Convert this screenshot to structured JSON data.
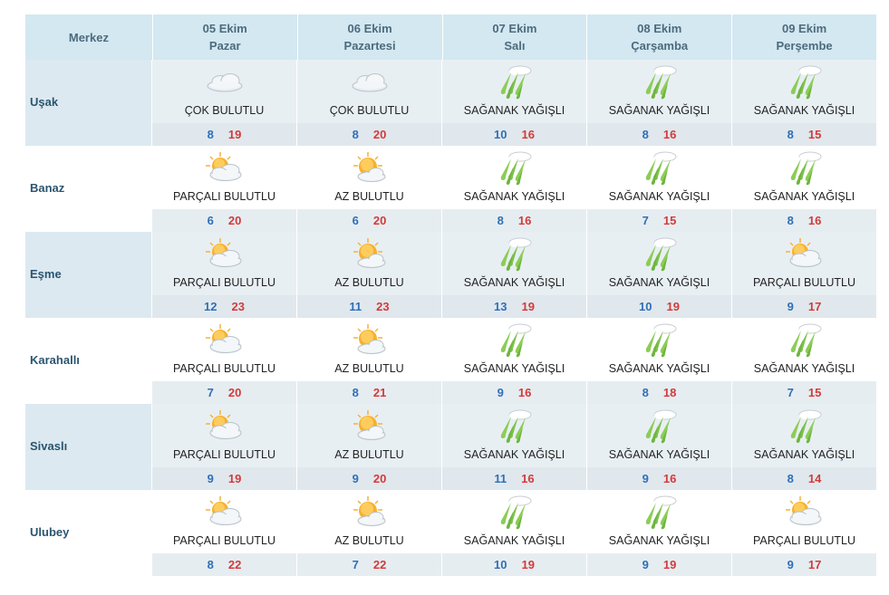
{
  "header": {
    "merkez_label": "Merkez",
    "days": [
      {
        "date": "05 Ekim",
        "weekday": "Pazar"
      },
      {
        "date": "06 Ekim",
        "weekday": "Pazartesi"
      },
      {
        "date": "07 Ekim",
        "weekday": "Salı"
      },
      {
        "date": "08 Ekim",
        "weekday": "Çarşamba"
      },
      {
        "date": "09 Ekim",
        "weekday": "Perşembe"
      }
    ]
  },
  "rows": [
    {
      "city": "Uşak",
      "days": [
        {
          "icon": "cloud-icon",
          "desc": "ÇOK BULUTLU",
          "min": "8",
          "max": "19"
        },
        {
          "icon": "cloud-icon",
          "desc": "ÇOK BULUTLU",
          "min": "8",
          "max": "20"
        },
        {
          "icon": "heavy-rain-icon",
          "desc": "SAĞANAK YAĞIŞLI",
          "min": "10",
          "max": "16"
        },
        {
          "icon": "heavy-rain-icon",
          "desc": "SAĞANAK YAĞIŞLI",
          "min": "8",
          "max": "16"
        },
        {
          "icon": "heavy-rain-icon",
          "desc": "SAĞANAK YAĞIŞLI",
          "min": "8",
          "max": "15"
        }
      ]
    },
    {
      "city": "Banaz",
      "days": [
        {
          "icon": "partly-cloudy-icon",
          "desc": "PARÇALI BULUTLU",
          "min": "6",
          "max": "20"
        },
        {
          "icon": "sun-cloud-icon",
          "desc": "AZ BULUTLU",
          "min": "6",
          "max": "20"
        },
        {
          "icon": "heavy-rain-icon",
          "desc": "SAĞANAK YAĞIŞLI",
          "min": "8",
          "max": "16"
        },
        {
          "icon": "heavy-rain-icon",
          "desc": "SAĞANAK YAĞIŞLI",
          "min": "7",
          "max": "15"
        },
        {
          "icon": "heavy-rain-icon",
          "desc": "SAĞANAK YAĞIŞLI",
          "min": "8",
          "max": "16"
        }
      ]
    },
    {
      "city": "Eşme",
      "days": [
        {
          "icon": "partly-cloudy-icon",
          "desc": "PARÇALI BULUTLU",
          "min": "12",
          "max": "23"
        },
        {
          "icon": "sun-cloud-icon",
          "desc": "AZ BULUTLU",
          "min": "11",
          "max": "23"
        },
        {
          "icon": "heavy-rain-icon",
          "desc": "SAĞANAK YAĞIŞLI",
          "min": "13",
          "max": "19"
        },
        {
          "icon": "heavy-rain-icon",
          "desc": "SAĞANAK YAĞIŞLI",
          "min": "10",
          "max": "19"
        },
        {
          "icon": "partly-cloudy-icon",
          "desc": "PARÇALI BULUTLU",
          "min": "9",
          "max": "17"
        }
      ]
    },
    {
      "city": "Karahallı",
      "days": [
        {
          "icon": "partly-cloudy-icon",
          "desc": "PARÇALI BULUTLU",
          "min": "7",
          "max": "20"
        },
        {
          "icon": "sun-cloud-icon",
          "desc": "AZ BULUTLU",
          "min": "8",
          "max": "21"
        },
        {
          "icon": "heavy-rain-icon",
          "desc": "SAĞANAK YAĞIŞLI",
          "min": "9",
          "max": "16"
        },
        {
          "icon": "heavy-rain-icon",
          "desc": "SAĞANAK YAĞIŞLI",
          "min": "8",
          "max": "18"
        },
        {
          "icon": "heavy-rain-icon",
          "desc": "SAĞANAK YAĞIŞLI",
          "min": "7",
          "max": "15"
        }
      ]
    },
    {
      "city": "Sivaslı",
      "days": [
        {
          "icon": "partly-cloudy-icon",
          "desc": "PARÇALI BULUTLU",
          "min": "9",
          "max": "19"
        },
        {
          "icon": "sun-cloud-icon",
          "desc": "AZ BULUTLU",
          "min": "9",
          "max": "20"
        },
        {
          "icon": "heavy-rain-icon",
          "desc": "SAĞANAK YAĞIŞLI",
          "min": "11",
          "max": "16"
        },
        {
          "icon": "heavy-rain-icon",
          "desc": "SAĞANAK YAĞIŞLI",
          "min": "9",
          "max": "16"
        },
        {
          "icon": "heavy-rain-icon",
          "desc": "SAĞANAK YAĞIŞLI",
          "min": "8",
          "max": "14"
        }
      ]
    },
    {
      "city": "Ulubey",
      "days": [
        {
          "icon": "partly-cloudy-icon",
          "desc": "PARÇALI BULUTLU",
          "min": "8",
          "max": "22"
        },
        {
          "icon": "sun-cloud-icon",
          "desc": "AZ BULUTLU",
          "min": "7",
          "max": "22"
        },
        {
          "icon": "heavy-rain-icon",
          "desc": "SAĞANAK YAĞIŞLI",
          "min": "10",
          "max": "19"
        },
        {
          "icon": "heavy-rain-icon",
          "desc": "SAĞANAK YAĞIŞLI",
          "min": "9",
          "max": "19"
        },
        {
          "icon": "partly-cloudy-icon",
          "desc": "PARÇALI BULUTLU",
          "min": "9",
          "max": "17"
        }
      ]
    }
  ],
  "colors": {
    "header_bg": "#d3e8f1",
    "min_temp": "#2f6fb6",
    "max_temp": "#d33a3a",
    "rain_green": "#7cc24a"
  }
}
